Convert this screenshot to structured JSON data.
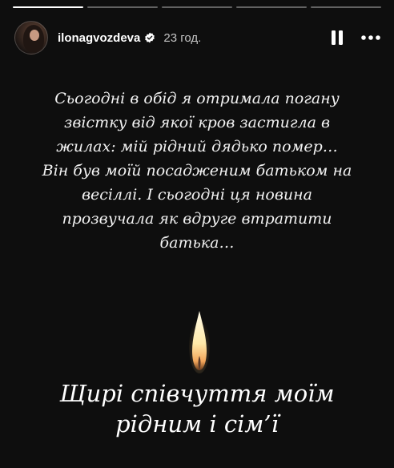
{
  "story": {
    "progress": [
      1,
      0,
      0,
      0,
      0
    ],
    "header": {
      "username": "ilonagvozdeva",
      "verified_icon": "verified-badge-icon",
      "time": "23 год.",
      "pause_icon": "pause-icon",
      "more_icon": "more-horizontal-icon"
    },
    "body_text": "Сьогодні в обід я отримала погану\nзвістку від якої кров застигла в\nжилах: мій рідний дядько помер…\nВін був моїй посадженим батьком на\nвесіллі. І сьогодні ця новина\nпрозвучала як вдруге втратити\nбатька…",
    "candle_icon": "candle-flame-icon",
    "closing_text": "Щирі співчуття моїм\nрідним і сім’ї",
    "colors": {
      "background": "#0e0e0e",
      "text": "#f2f2f2",
      "verified": "#ffffff"
    }
  }
}
